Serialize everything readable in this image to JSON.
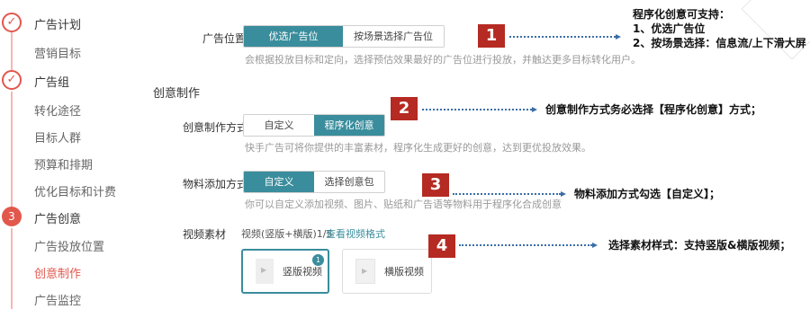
{
  "sidebar": {
    "items": [
      {
        "label": "广告计划"
      },
      {
        "label": "营销目标"
      },
      {
        "label": "广告组"
      },
      {
        "label": "转化途径"
      },
      {
        "label": "目标人群"
      },
      {
        "label": "预算和排期"
      },
      {
        "label": "优化目标和计费"
      },
      {
        "label": "广告创意"
      },
      {
        "label": "广告投放位置"
      },
      {
        "label": "创意制作"
      },
      {
        "label": "广告监控"
      }
    ],
    "step3": "3"
  },
  "placement": {
    "label": "广告位置",
    "options": [
      "优选广告位",
      "按场景选择广告位"
    ],
    "hint": "会根据投放目标和定向，选择预估效果最好的广告位进行投放，并触达更多目标转化用户。"
  },
  "section_title": "创意制作",
  "creative_method": {
    "label": "创意制作方式",
    "options": [
      "自定义",
      "程序化创意"
    ],
    "hint": "快手广告可将你提供的丰富素材，程序化生成更好的创意，达到更优投放效果。"
  },
  "material_method": {
    "label": "物料添加方式",
    "options": [
      "自定义",
      "选择创意包"
    ],
    "hint": "你可以自定义添加视频、图片、贴纸和广告语等物料用于程序化合成创意"
  },
  "video": {
    "label": "视频素材",
    "count": "视频(竖版+横版)1/5",
    "view_format": "查看视频格式",
    "cards": [
      "竖版视频",
      "横版视频"
    ],
    "badge": "1"
  },
  "annotations": {
    "n1": "1",
    "n2": "2",
    "n3": "3",
    "n4": "4",
    "a1_l1": "程序化创意可支持：",
    "a1_l2": "1、优选广告位",
    "a1_l3": "2、按场景选择：信息流/上下滑大屏",
    "a2": "创意制作方式务必选择【程序化创意】方式；",
    "a3": "物料添加方式勾选【自定义】；",
    "a4": "选择素材样式：支持竖版&横版视频；"
  }
}
